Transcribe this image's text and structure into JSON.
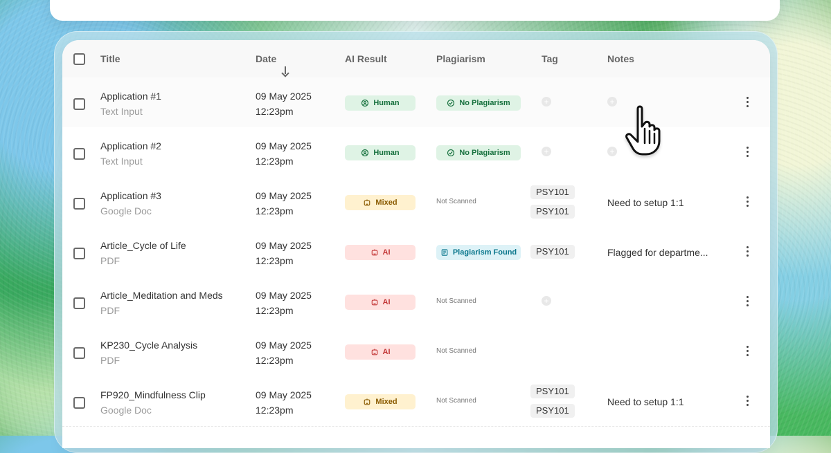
{
  "table": {
    "headers": {
      "title": "Title",
      "date": "Date",
      "ai_result": "AI Result",
      "plagiarism": "Plagiarism",
      "tag": "Tag",
      "notes": "Notes"
    },
    "rows": [
      {
        "title": "Application #1",
        "source": "Text Input",
        "date": "09 May 2025",
        "time": "12:23pm",
        "ai_result": "Human",
        "plagiarism": "No Plagiarism",
        "tags": [],
        "notes": ""
      },
      {
        "title": "Application #2",
        "source": "Text Input",
        "date": "09 May 2025",
        "time": "12:23pm",
        "ai_result": "Human",
        "plagiarism": "No Plagiarism",
        "tags": [],
        "notes": ""
      },
      {
        "title": "Application #3",
        "source": "Google Doc",
        "date": "09 May 2025",
        "time": "12:23pm",
        "ai_result": "Mixed",
        "plagiarism": "Not Scanned",
        "tags": [
          "PSY101",
          "PSY101"
        ],
        "notes": "Need to setup 1:1"
      },
      {
        "title": "Article_Cycle of Life",
        "source": "PDF",
        "date": "09 May 2025",
        "time": "12:23pm",
        "ai_result": "AI",
        "plagiarism": "Plagiarism Found",
        "tags": [
          "PSY101"
        ],
        "notes": "Flagged for departme..."
      },
      {
        "title": "Article_Meditation and Meds",
        "source": "PDF",
        "date": "09 May 2025",
        "time": "12:23pm",
        "ai_result": "AI",
        "plagiarism": "Not Scanned",
        "tags": [],
        "notes": ""
      },
      {
        "title": "KP230_Cycle Analysis",
        "source": "PDF",
        "date": "09 May 2025",
        "time": "12:23pm",
        "ai_result": "AI",
        "plagiarism": "Not Scanned",
        "tags": [],
        "notes": ""
      },
      {
        "title": "FP920_Mindfulness Clip",
        "source": "Google Doc",
        "date": "09 May 2025",
        "time": "12:23pm",
        "ai_result": "Mixed",
        "plagiarism": "Not Scanned",
        "tags": [
          "PSY101",
          "PSY101"
        ],
        "notes": "Need to setup 1:1"
      }
    ]
  },
  "colors": {
    "human_badge": "#dff3e5",
    "mixed_badge": "#fff1cf",
    "ai_badge": "#ffe1df",
    "plagiarism_found_badge": "#ddf2f7"
  },
  "icons": {
    "human": "person-circle-icon",
    "mixed": "robot-icon",
    "ai": "robot-icon",
    "no_plagiarism": "check-circle-icon",
    "plagiarism_found": "document-icon",
    "row_menu": "more-vertical-icon",
    "cursor": "hand-cursor-icon"
  }
}
